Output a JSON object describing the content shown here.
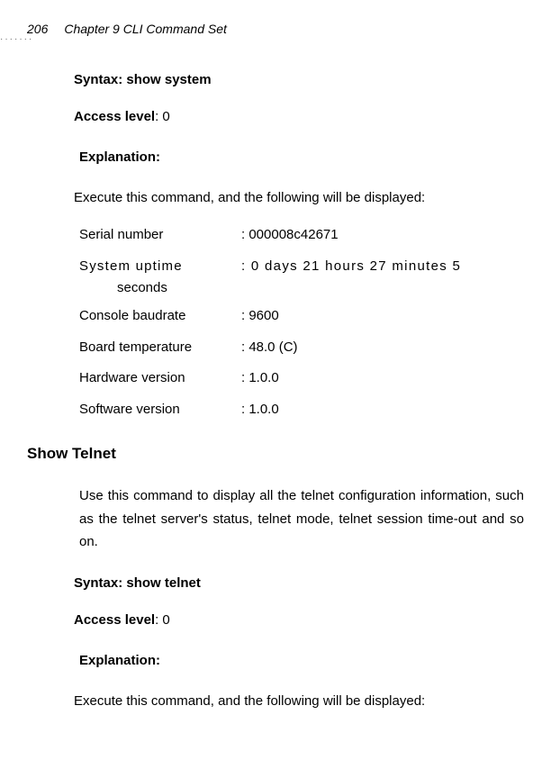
{
  "header": {
    "pageNumber": "206",
    "chapterTitle": "Chapter 9 CLI Command Set"
  },
  "section1": {
    "syntaxLabel": "Syntax: show system",
    "accessLabel": "Access level",
    "accessValue": ": 0",
    "explanationLabel": "Explanation:",
    "execText": "Execute this command, and the following will be displayed:",
    "rows": [
      {
        "label": "Serial number",
        "value": ": 000008c42671"
      },
      {
        "label": "System uptime",
        "value": ": 0 days 21 hours 27 minutes 5"
      },
      {
        "label": "Console baudrate",
        "value": ": 9600"
      },
      {
        "label": "Board temperature",
        "value": ": 48.0 (C)"
      },
      {
        "label": "Hardware version",
        "value": ": 1.0.0"
      },
      {
        "label": "Software version",
        "value": ": 1.0.0"
      }
    ],
    "secondsText": "seconds"
  },
  "section2": {
    "heading": "Show Telnet",
    "description": "Use this command to display all the telnet configuration information, such as the telnet server's status, telnet mode, telnet session time-out and so on.",
    "syntaxLabel": "Syntax: show telnet",
    "accessLabel": "Access level",
    "accessValue": ": 0",
    "explanationLabel": "Explanation:",
    "execText": "Execute this command, and the following will be displayed:"
  }
}
